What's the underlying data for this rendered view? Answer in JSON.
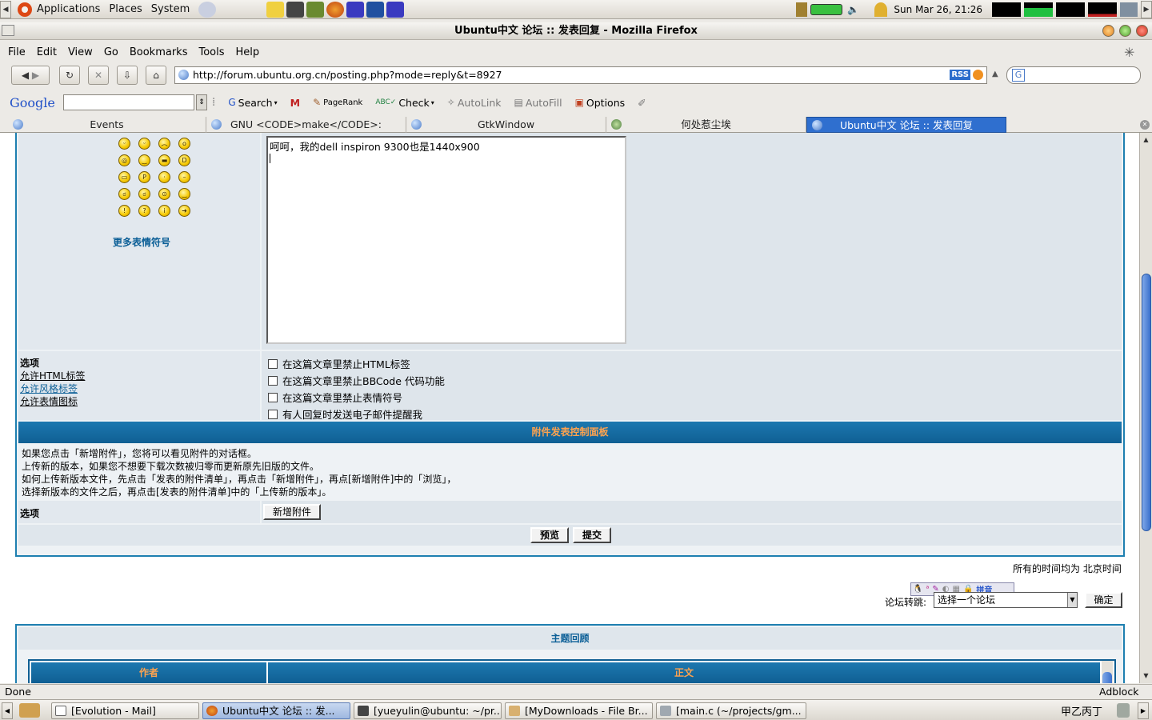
{
  "top_panel": {
    "menus": [
      "Applications",
      "Places",
      "System"
    ],
    "clock": "Sun Mar 26, 21:26"
  },
  "window": {
    "title": "Ubuntu中文 论坛 :: 发表回复 - Mozilla Firefox"
  },
  "menubar": [
    "File",
    "Edit",
    "View",
    "Go",
    "Bookmarks",
    "Tools",
    "Help"
  ],
  "navbar": {
    "url": "http://forum.ubuntu.org.cn/posting.php?mode=reply&t=8927",
    "rss": "RSS"
  },
  "google_toolbar": {
    "logo": "Google",
    "search_label": "Search",
    "pagerank_label": "PageRank",
    "check_label": "Check",
    "autolink_label": "AutoLink",
    "autofill_label": "AutoFill",
    "options_label": "Options"
  },
  "tabs": [
    {
      "label": "Events"
    },
    {
      "label": "GNU <CODE>make</CODE>: Overview"
    },
    {
      "label": "GtkWindow"
    },
    {
      "label": "何处惹尘埃"
    },
    {
      "label": "Ubuntu中文 论坛 :: 发表回复"
    }
  ],
  "post_form": {
    "message": "呵呵，我的dell inspiron 9300也是1440x900",
    "more_smilies": "更多表情符号",
    "options_title": "选项",
    "option_links": [
      "允许HTML标签",
      "允许风格标签",
      "允许表情图标"
    ],
    "checkboxes": [
      "在这篇文章里禁止HTML标签",
      "在这篇文章里禁止BBCode 代码功能",
      "在这篇文章里禁止表情符号",
      "有人回复时发送电子邮件提醒我"
    ]
  },
  "attachment_panel": {
    "title": "附件发表控制面板",
    "lines": [
      "如果您点击「新增附件」，您将可以看见附件的对话框。",
      "上传新的版本，如果您不想要下载次数被归零而更新原先旧版的文件。",
      "如何上传新版本文件，先点击「发表的附件清单」，再点击「新增附件」，再点[新增附件]中的「浏览」，",
      "选择新版本的文件之后，再点击[发表的附件清单]中的「上传新的版本」。"
    ],
    "options_label": "选项",
    "add_button": "新增附件"
  },
  "actions": {
    "preview": "预览",
    "submit": "提交"
  },
  "timezone_note": "所有的时间均为 北京时间",
  "ime": {
    "pinyin": "拼音"
  },
  "forum_jump": {
    "label": "论坛转跳:",
    "selected": "选择一个论坛",
    "go": "确定"
  },
  "topic_review": {
    "title": "主题回顾",
    "col_author": "作者",
    "col_body": "正文"
  },
  "status": {
    "text": "Done",
    "adblock": "Adblock"
  },
  "taskbar": [
    {
      "label": "[Evolution - Mail]"
    },
    {
      "label": "Ubuntu中文 论坛 :: 发..."
    },
    {
      "label": "[yueyulin@ubuntu: ~/pr..."
    },
    {
      "label": "[MyDownloads - File Br..."
    },
    {
      "label": "[main.c (~/projects/gm..."
    }
  ],
  "ime_tray": "甲乙丙丁"
}
